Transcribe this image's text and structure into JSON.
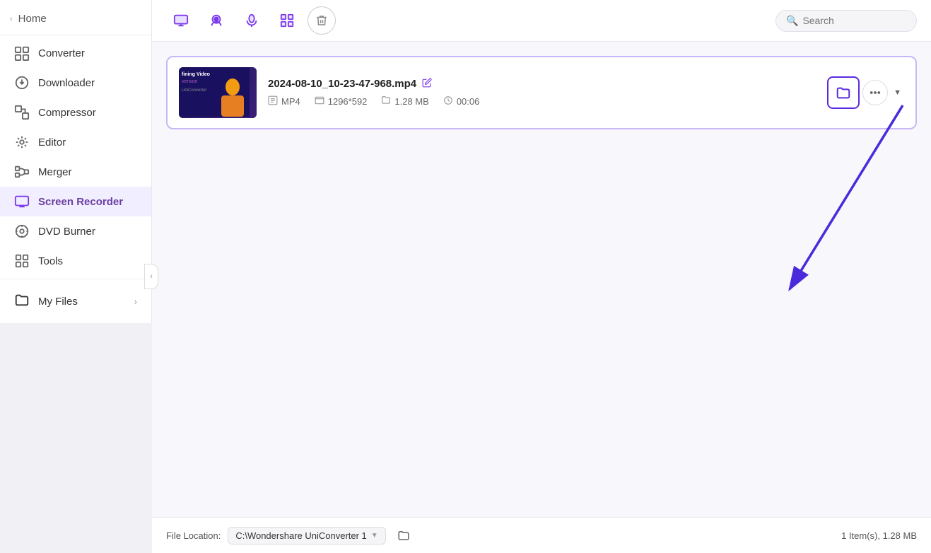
{
  "sidebar": {
    "home_label": "Home",
    "items": [
      {
        "id": "converter",
        "label": "Converter",
        "icon": "converter"
      },
      {
        "id": "downloader",
        "label": "Downloader",
        "icon": "downloader"
      },
      {
        "id": "compressor",
        "label": "Compressor",
        "icon": "compressor"
      },
      {
        "id": "editor",
        "label": "Editor",
        "icon": "editor"
      },
      {
        "id": "merger",
        "label": "Merger",
        "icon": "merger"
      },
      {
        "id": "screen-recorder",
        "label": "Screen Recorder",
        "icon": "screen-recorder"
      },
      {
        "id": "dvd-burner",
        "label": "DVD Burner",
        "icon": "dvd-burner"
      },
      {
        "id": "tools",
        "label": "Tools",
        "icon": "tools"
      }
    ],
    "my_files_label": "My Files",
    "active_item": "screen-recorder"
  },
  "toolbar": {
    "search_placeholder": "Search",
    "tool_icons": [
      "screen",
      "webcam",
      "audio",
      "apps",
      "delete"
    ]
  },
  "file": {
    "name": "2024-08-10_10-23-47-968.mp4",
    "format": "MP4",
    "resolution": "1296*592",
    "size": "1.28 MB",
    "duration": "00:06",
    "thumbnail_line1": "fining Video",
    "thumbnail_line2": "version"
  },
  "footer": {
    "file_location_label": "File Location:",
    "location_value": "C:\\Wondershare UniConverter 1",
    "summary": "1 Item(s), 1.28 MB"
  },
  "annotation": {
    "visible": true
  }
}
